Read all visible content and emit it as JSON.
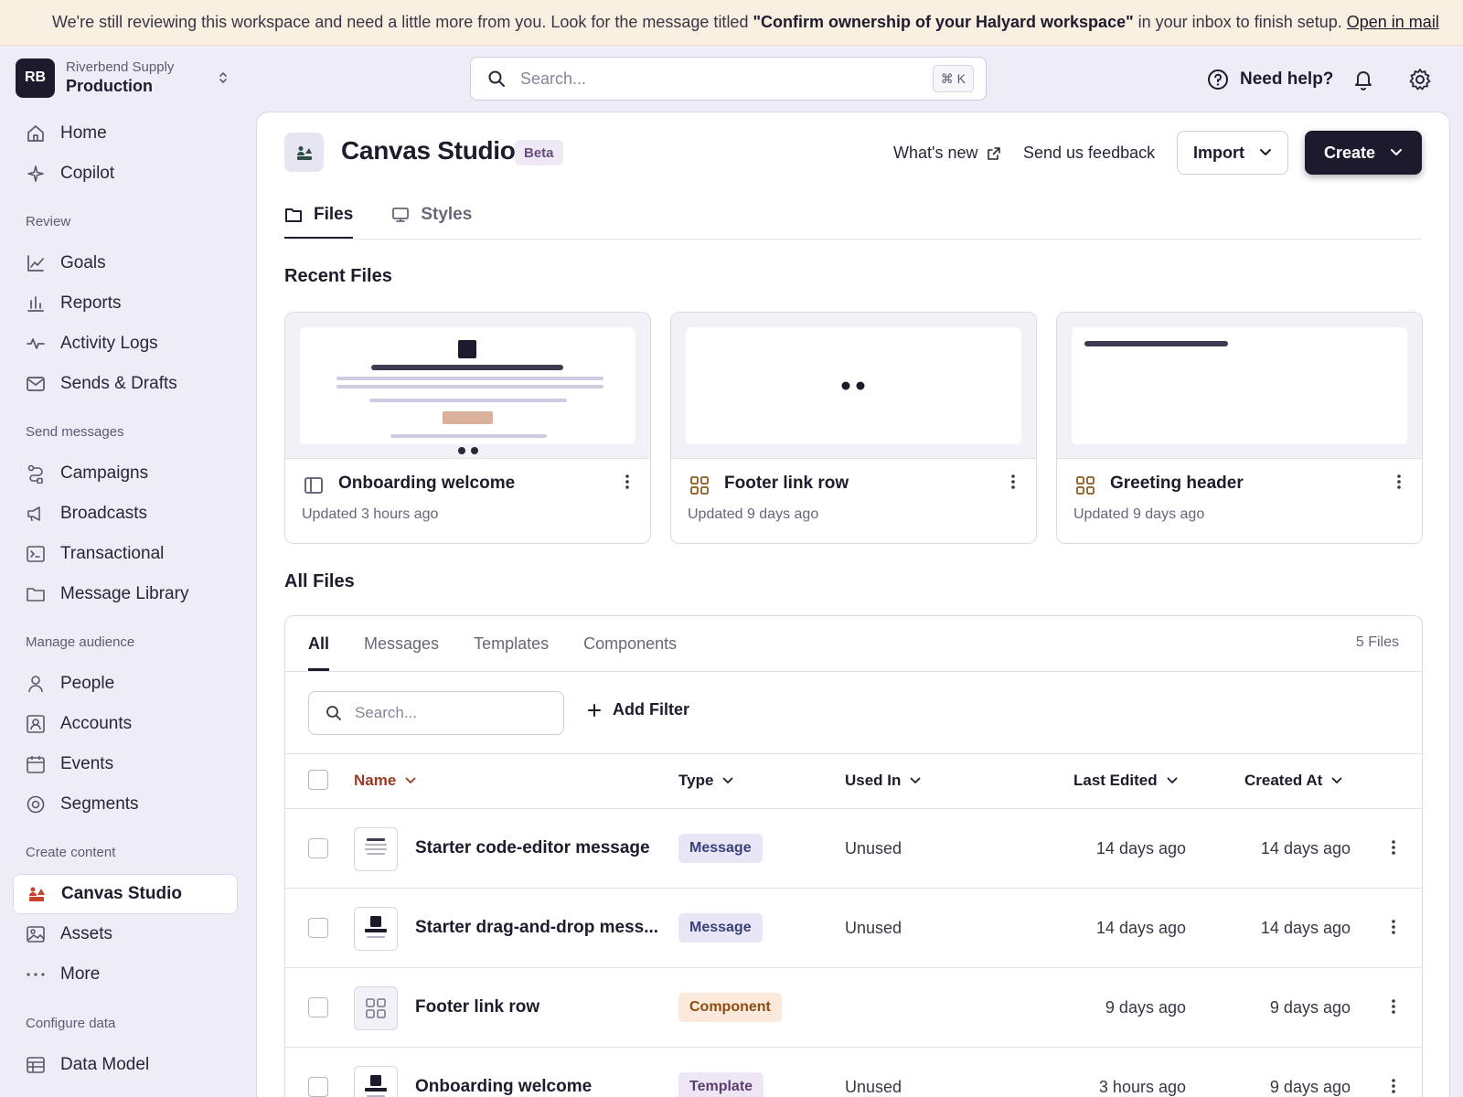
{
  "banner": {
    "text_before": "We're still reviewing this workspace and need a little more from you. Look for the message titled",
    "bold_title": "\"Confirm ownership of your Halyard workspace\"",
    "text_after": "in your inbox to finish setup.",
    "link": "Open in mail"
  },
  "workspace": {
    "initials": "RB",
    "org": "Riverbend Supply",
    "env": "Production"
  },
  "sidebar": {
    "top": [
      {
        "label": "Home",
        "icon": "home-icon"
      },
      {
        "label": "Copilot",
        "icon": "sparkle-icon"
      }
    ],
    "sections": [
      {
        "title": "Review",
        "items": [
          {
            "label": "Goals",
            "icon": "trend-icon"
          },
          {
            "label": "Reports",
            "icon": "bar-chart-icon"
          },
          {
            "label": "Activity Logs",
            "icon": "pulse-icon"
          },
          {
            "label": "Sends & Drafts",
            "icon": "mail-icon"
          }
        ]
      },
      {
        "title": "Send messages",
        "items": [
          {
            "label": "Campaigns",
            "icon": "workflow-icon"
          },
          {
            "label": "Broadcasts",
            "icon": "megaphone-icon"
          },
          {
            "label": "Transactional",
            "icon": "terminal-icon"
          },
          {
            "label": "Message Library",
            "icon": "folder-icon"
          }
        ]
      },
      {
        "title": "Manage audience",
        "items": [
          {
            "label": "People",
            "icon": "person-icon"
          },
          {
            "label": "Accounts",
            "icon": "account-icon"
          },
          {
            "label": "Events",
            "icon": "calendar-icon"
          },
          {
            "label": "Segments",
            "icon": "target-icon"
          }
        ]
      },
      {
        "title": "Create content",
        "items": [
          {
            "label": "Canvas Studio",
            "icon": "canvas-icon",
            "active": true
          },
          {
            "label": "Assets",
            "icon": "image-icon"
          },
          {
            "label": "More",
            "icon": "ellipsis-icon"
          }
        ]
      },
      {
        "title": "Configure data",
        "items": [
          {
            "label": "Data Model",
            "icon": "table-icon"
          }
        ]
      }
    ]
  },
  "topbar": {
    "search_placeholder": "Search...",
    "shortcut": "⌘ K",
    "help": "Need help?"
  },
  "page": {
    "title": "Canvas Studio",
    "badge": "Beta",
    "whats_new": "What's new",
    "feedback": "Send us feedback",
    "import": "Import",
    "create": "Create",
    "tabs": [
      "Files",
      "Styles"
    ]
  },
  "recent": {
    "title": "Recent Files",
    "cards": [
      {
        "name": "Onboarding welcome",
        "time": "Updated 3 hours ago",
        "icon": "layout-icon"
      },
      {
        "name": "Footer link row",
        "time": "Updated 9 days ago",
        "icon": "component-icon"
      },
      {
        "name": "Greeting header",
        "time": "Updated 9 days ago",
        "icon": "component-icon"
      }
    ]
  },
  "all_files": {
    "title": "All Files",
    "filter_tabs": [
      "All",
      "Messages",
      "Templates",
      "Components"
    ],
    "count": "5 Files",
    "search_placeholder": "Search...",
    "add_filter": "Add Filter",
    "columns": [
      "Name",
      "Type",
      "Used In",
      "Last Edited",
      "Created At"
    ],
    "rows": [
      {
        "name": "Starter code-editor message",
        "type": "Message",
        "type_class": "message",
        "used_in": "Unused",
        "last_edited": "14 days ago",
        "created_at": "14 days ago",
        "thumb": "code"
      },
      {
        "name": "Starter drag-and-drop mess...",
        "type": "Message",
        "type_class": "message",
        "used_in": "Unused",
        "last_edited": "14 days ago",
        "created_at": "14 days ago",
        "thumb": "dnd"
      },
      {
        "name": "Footer link row",
        "type": "Component",
        "type_class": "component",
        "used_in": "",
        "last_edited": "9 days ago",
        "created_at": "9 days ago",
        "thumb": "grid"
      },
      {
        "name": "Onboarding welcome",
        "type": "Template",
        "type_class": "template",
        "used_in": "Unused",
        "last_edited": "3 hours ago",
        "created_at": "9 days ago",
        "thumb": "dnd"
      }
    ]
  },
  "colors": {
    "primary_dark": "#1d1a2e",
    "accent": "#c4432a",
    "sorted_header": "#9a3a24"
  }
}
